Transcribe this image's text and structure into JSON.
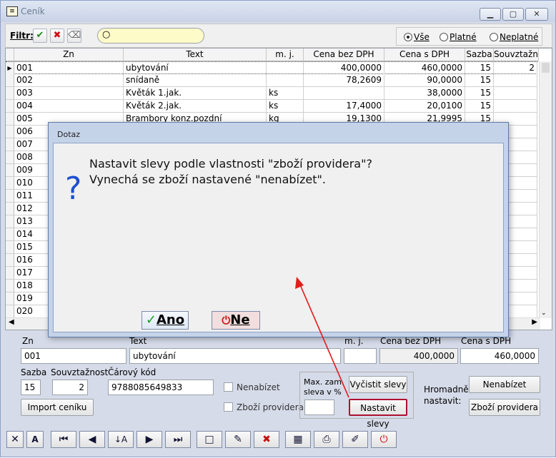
{
  "window": {
    "title": "Ceník"
  },
  "filter": {
    "label": "Filtr:",
    "search_placeholder": "",
    "radios": [
      {
        "label": "Vše",
        "checked": true
      },
      {
        "label": "Platné",
        "checked": false
      },
      {
        "label": "Neplatné",
        "checked": false
      }
    ]
  },
  "grid": {
    "columns": [
      "Zn",
      "Text",
      "m. j.",
      "Cena bez DPH",
      "Cena s DPH",
      "Sazba",
      "Souvztažno"
    ],
    "rows": [
      {
        "zn": "001",
        "text": "ubytování",
        "mj": "",
        "bez": "400,0000",
        "s": "460,0000",
        "sazba": "15",
        "souv": "2"
      },
      {
        "zn": "002",
        "text": "snídaně",
        "mj": "",
        "bez": "78,2609",
        "s": "90,0000",
        "sazba": "15",
        "souv": ""
      },
      {
        "zn": "003",
        "text": "Květák 1.jak.",
        "mj": "ks",
        "bez": "",
        "s": "38,0000",
        "sazba": "15",
        "souv": ""
      },
      {
        "zn": "004",
        "text": "Květák 2.jak.",
        "mj": "ks",
        "bez": "17,4000",
        "s": "20,0100",
        "sazba": "15",
        "souv": ""
      },
      {
        "zn": "005",
        "text": "Brambory konz.pozdní",
        "mj": "kg",
        "bez": "19,1300",
        "s": "21,9995",
        "sazba": "15",
        "souv": ""
      },
      {
        "zn": "006",
        "text": "",
        "mj": "",
        "bez": "",
        "s": "",
        "sazba": "",
        "souv": ""
      },
      {
        "zn": "007",
        "text": "",
        "mj": "",
        "bez": "",
        "s": "",
        "sazba": "",
        "souv": ""
      },
      {
        "zn": "008",
        "text": "",
        "mj": "",
        "bez": "",
        "s": "",
        "sazba": "",
        "souv": ""
      },
      {
        "zn": "009",
        "text": "",
        "mj": "",
        "bez": "",
        "s": "",
        "sazba": "",
        "souv": ""
      },
      {
        "zn": "010",
        "text": "",
        "mj": "",
        "bez": "",
        "s": "",
        "sazba": "",
        "souv": ""
      },
      {
        "zn": "011",
        "text": "",
        "mj": "",
        "bez": "",
        "s": "",
        "sazba": "",
        "souv": ""
      },
      {
        "zn": "012",
        "text": "",
        "mj": "",
        "bez": "",
        "s": "",
        "sazba": "",
        "souv": ""
      },
      {
        "zn": "013",
        "text": "",
        "mj": "",
        "bez": "",
        "s": "",
        "sazba": "",
        "souv": ""
      },
      {
        "zn": "014",
        "text": "",
        "mj": "",
        "bez": "",
        "s": "",
        "sazba": "",
        "souv": ""
      },
      {
        "zn": "015",
        "text": "",
        "mj": "",
        "bez": "",
        "s": "",
        "sazba": "",
        "souv": ""
      },
      {
        "zn": "016",
        "text": "",
        "mj": "",
        "bez": "",
        "s": "",
        "sazba": "",
        "souv": ""
      },
      {
        "zn": "017",
        "text": "",
        "mj": "",
        "bez": "",
        "s": "",
        "sazba": "",
        "souv": ""
      },
      {
        "zn": "018",
        "text": "",
        "mj": "",
        "bez": "",
        "s": "",
        "sazba": "",
        "souv": ""
      },
      {
        "zn": "019",
        "text": "",
        "mj": "",
        "bez": "",
        "s": "",
        "sazba": "",
        "souv": ""
      },
      {
        "zn": "020",
        "text": "",
        "mj": "",
        "bez": "",
        "s": "",
        "sazba": "",
        "souv": ""
      }
    ]
  },
  "detail": {
    "zn_label": "Zn",
    "text_label": "Text",
    "mj_label": "m. j.",
    "bez_label": "Cena bez DPH",
    "s_label": "Cena s DPH",
    "zn": "001",
    "text": "ubytování",
    "mj": "",
    "bez": "400,0000",
    "s": "460,0000",
    "sazba_label": "Sazba",
    "souv_label": "Souvztažnost",
    "ean_label": "Čárový kód",
    "sazba": "15",
    "souv": "2",
    "ean": "9788085649833",
    "nenabizet": "Nenabízet",
    "zbozi_providera": "Zboží providera",
    "import_btn": "Import ceníku",
    "max_label1": "Max. zam.",
    "max_label2": "sleva v %",
    "vycistit_btn": "Vyčistit slevy",
    "nastavit_btn": "Nastavit slevy",
    "hrom_label1": "Hromadně",
    "hrom_label2": "nastavit:",
    "hrom_nenabizet": "Nenabízet",
    "hrom_zbozi": "Zboží providera"
  },
  "dialog": {
    "title": "Dotaz",
    "line1": "Nastavit slevy podle vlastnosti \"zboží providera\"?",
    "line2": "Vynechá se zboží nastavené \"nenabízet\".",
    "icon": "?",
    "yes": "Ano",
    "no": "Ne"
  }
}
